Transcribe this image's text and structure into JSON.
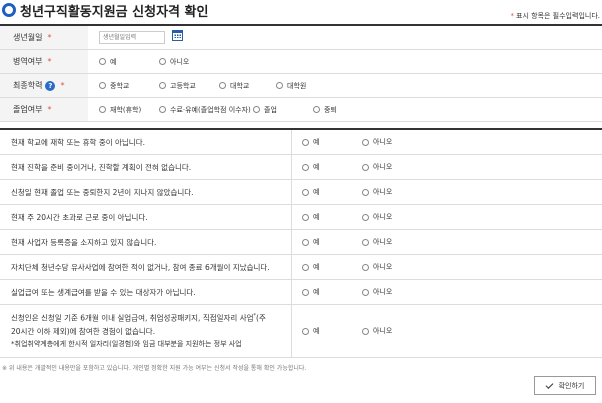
{
  "header": {
    "title": "청년구직활동지원금 신청자격 확인",
    "required_note": "표시 항목은 필수입력입니다.",
    "required_mark": "*"
  },
  "form": {
    "birth": {
      "label": "생년월일",
      "placeholder": "생년월일입력"
    },
    "military": {
      "label": "병역여부",
      "options": [
        "예",
        "아니오"
      ]
    },
    "education": {
      "label": "최종학력",
      "options": [
        "중학교",
        "고등학교",
        "대학교",
        "대학원"
      ]
    },
    "graduation": {
      "label": "졸업여부",
      "options": [
        "재학(휴학)",
        "수료·유예(졸업학점 이수자)",
        "졸업",
        "중퇴"
      ]
    }
  },
  "questions": [
    {
      "text": "현재 학교에 재학 또는 휴학 중이 아닙니다.",
      "yes": "예",
      "no": "아니오"
    },
    {
      "text": "현재 진학을 준비 중이거나, 진학할 계획이 전혀 없습니다.",
      "yes": "예",
      "no": "아니오"
    },
    {
      "text": "신청일 현재 졸업 또는 중퇴한지 2년이 지나지 않았습니다.",
      "yes": "예",
      "no": "아니오"
    },
    {
      "text": "현재 주 20시간 초과로 근로 중이 아닙니다.",
      "yes": "예",
      "no": "아니오"
    },
    {
      "text": "현재 사업자 등록증을 소지하고 있지 않습니다.",
      "yes": "예",
      "no": "아니오"
    },
    {
      "text": "자치단체 청년수당 유사사업에 참여한 적이 없거나, 참여 종료 6개월이 지났습니다.",
      "yes": "예",
      "no": "아니오"
    },
    {
      "text": "실업급여 또는 생계급여를 받을 수 있는 대상자가 아닙니다.",
      "yes": "예",
      "no": "아니오"
    }
  ],
  "last_question": {
    "line1": "신청인은 신청일 기준 6개월 이내 실업급여, 취업성공패키지, 직접일자리 사업",
    "sup": "*",
    "line1_end": "(주",
    "line2": "20시간 이하 제외)에 참여한 경험이 없습니다.",
    "note": "*취업취약계층에게 한시적 일자리(일경험)와 임금 대부분을 지원하는 정부 사업",
    "yes": "예",
    "no": "아니오"
  },
  "footer": {
    "note": "※ 위 내용은 개괄적인 내용만을 포함하고 있습니다. 개인별 정확한 지원 가능 여부는 신청서 작성을 통해 확인 가능합니다.",
    "confirm_label": "확인하기"
  }
}
